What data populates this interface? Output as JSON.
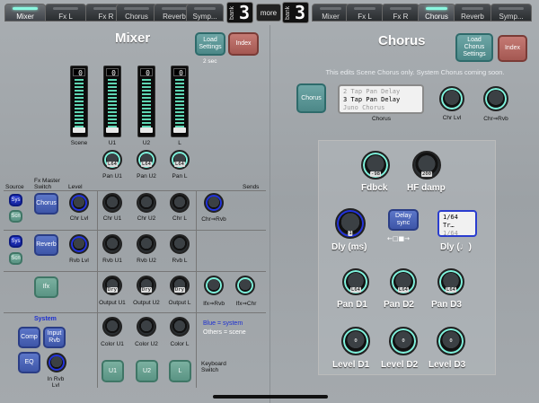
{
  "tabs_left": [
    {
      "label": "Mixer",
      "active": true
    },
    {
      "label": "Fx L",
      "active": false
    },
    {
      "label": "Fx R",
      "active": false
    },
    {
      "label": "Chorus",
      "active": false
    },
    {
      "label": "Reverb",
      "active": false
    },
    {
      "label": "Symp...",
      "active": false
    }
  ],
  "bank_left": {
    "label": "bank",
    "number": "3"
  },
  "more_label": "more",
  "bank_right": {
    "label": "bank",
    "number": "3"
  },
  "tabs_right": [
    {
      "label": "Mixer",
      "active": false
    },
    {
      "label": "Fx L",
      "active": false
    },
    {
      "label": "Fx R",
      "active": false
    },
    {
      "label": "Chorus",
      "active": true
    },
    {
      "label": "Reverb",
      "active": false
    },
    {
      "label": "Symp...",
      "active": false
    }
  ],
  "mixer": {
    "title": "Mixer",
    "load_settings": "Load Settings",
    "load_hint": "2 sec",
    "index": "Index",
    "faders": [
      {
        "label": "Scene",
        "value": "0"
      },
      {
        "label": "U1",
        "value": "0"
      },
      {
        "label": "U2",
        "value": "0"
      },
      {
        "label": "L",
        "value": "0"
      }
    ],
    "pan_knobs": [
      {
        "label": "Pan U1",
        "sub": "L64"
      },
      {
        "label": "Pan U2",
        "sub": "L64"
      },
      {
        "label": "Pan L",
        "sub": "L64"
      }
    ],
    "col_headers": {
      "source": "Source",
      "fx_master": "Fx Master",
      "switch": "Switch",
      "level": "Level",
      "sends": "Sends"
    },
    "chorus_row": {
      "sys": "Sys",
      "scn": "Scn",
      "button": "Chorus",
      "lvl": "Chr Lvl",
      "u1": "Chr U1",
      "u2": "Chr U2",
      "l": "Chr L",
      "send": "Chr⇒Rvb"
    },
    "reverb_row": {
      "sys": "Sys",
      "scn": "Scn",
      "button": "Reverb",
      "lvl": "Rvb Lvl",
      "u1": "Rvb U1",
      "u2": "Rvb U2",
      "l": "Rvb L"
    },
    "ifx_row": {
      "button": "Ifx",
      "u1": "Output U1",
      "u2": "Output U2",
      "l": "Output L",
      "sub": "Dry",
      "send1": "Ifx⇒Rvb",
      "send2": "Ifx⇒Chr"
    },
    "system": {
      "title": "System",
      "comp": "Comp",
      "input_rvb": "Input Rvb",
      "eq": "EQ",
      "in_rvb_lvl": "In Rvb Lvl"
    },
    "color_row": {
      "u1": "Color U1",
      "u2": "Color U2",
      "l": "Color L"
    },
    "legend": {
      "blue": "Blue = system",
      "others": "Others = scene"
    },
    "keyboard": {
      "u1": "U1",
      "u2": "U2",
      "l": "L",
      "label": "Keyboard Switch"
    }
  },
  "chorus": {
    "title": "Chorus",
    "load": "Load Chorus Settings",
    "index": "Index",
    "note": "This edits Scene Chorus only. System Chorus coming soon.",
    "button": "Chorus",
    "list": [
      "2 Tap Pan Delay",
      "3 Tap Pan Delay",
      "Juno Chorus"
    ],
    "list_selected": 1,
    "list_label": "Chorus",
    "chr_lvl": "Chr Lvl",
    "chr_rvb": "Chr⇒Rvb",
    "fdbck": {
      "label": "Fdbck",
      "value": "-98"
    },
    "hf_damp": {
      "label": "HF damp",
      "value": "200"
    },
    "dly_ms": {
      "label": "Dly (ms)",
      "value": "1"
    },
    "delay_sync": "Delay sync",
    "dly_note": {
      "label": "Dly (♩)",
      "items": [
        "1/64 Tr…",
        "1/64"
      ]
    },
    "pans": [
      {
        "label": "Pan D1",
        "sub": "L64"
      },
      {
        "label": "Pan D2",
        "sub": "L64"
      },
      {
        "label": "Pan D3",
        "sub": "L64"
      }
    ],
    "levels": [
      {
        "label": "Level D1",
        "value": "0"
      },
      {
        "label": "Level D2",
        "value": "0"
      },
      {
        "label": "Level D3",
        "value": "0"
      }
    ]
  }
}
